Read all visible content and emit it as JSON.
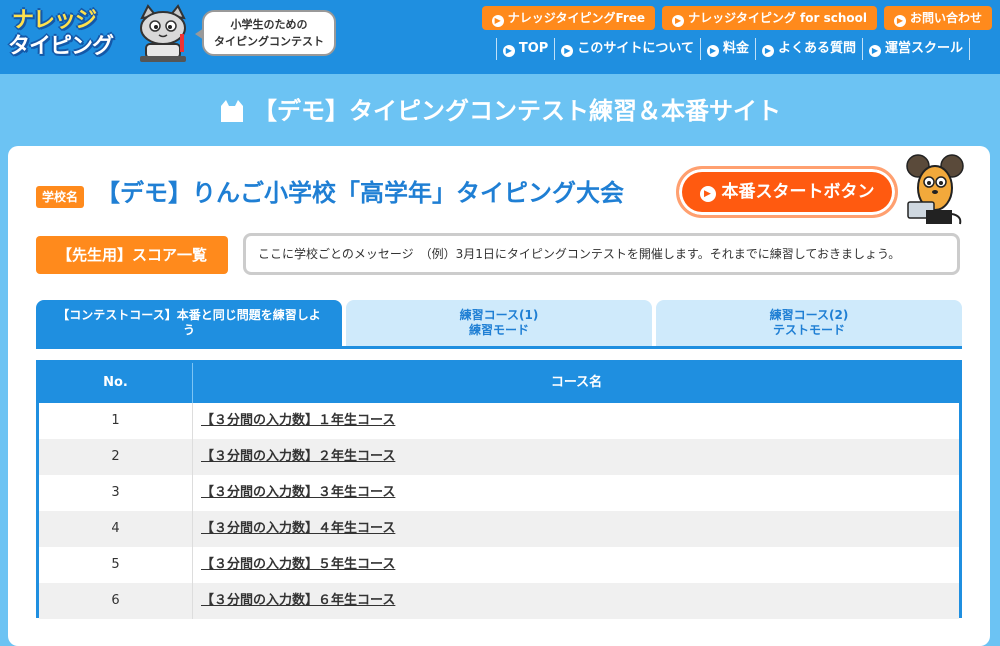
{
  "header": {
    "logo_line1": "ナレッジ",
    "logo_line2": "タイピング",
    "bubble_line1": "小学生のための",
    "bubble_line2": "タイピングコンテスト",
    "top_buttons": [
      "ナレッジタイピングFree",
      "ナレッジタイピング for school",
      "お問い合わせ"
    ],
    "nav": [
      "TOP",
      "このサイトについて",
      "料金",
      "よくある質問",
      "運営スクール"
    ]
  },
  "page_title": "【デモ】タイピングコンテスト練習＆本番サイト",
  "school": {
    "badge": "学校名",
    "title": "【デモ】りんご小学校「高学年」タイピング大会"
  },
  "start_button": "本番スタートボタン",
  "score_button": "【先生用】スコア一覧",
  "message": "ここに学校ごとのメッセージ　（例）3月1日にタイピングコンテストを開催します。それまでに練習しておきましょう。",
  "tabs": [
    {
      "line1": "【コンテストコース】本番と同じ問題を練習しよ",
      "line2": "う"
    },
    {
      "line1": "練習コース(1)",
      "line2": "練習モード"
    },
    {
      "line1": "練習コース(2)",
      "line2": "テストモード"
    }
  ],
  "table": {
    "headers": [
      "No.",
      "コース名"
    ],
    "rows": [
      {
        "no": "1",
        "name": "【３分間の入力数】１年生コース"
      },
      {
        "no": "2",
        "name": "【３分間の入力数】２年生コース"
      },
      {
        "no": "3",
        "name": "【３分間の入力数】３年生コース"
      },
      {
        "no": "4",
        "name": "【３分間の入力数】４年生コース"
      },
      {
        "no": "5",
        "name": "【３分間の入力数】５年生コース"
      },
      {
        "no": "6",
        "name": "【３分間の入力数】６年生コース"
      }
    ]
  },
  "colors": {
    "header_blue": "#1f8fe0",
    "sky_bg": "#6cc3f3",
    "orange": "#ff8a1c",
    "start_red": "#ff5a10"
  },
  "icons": [
    "play-arrow-icon",
    "cat-head-icon",
    "cat-mascot-icon",
    "mouse-mascot-icon"
  ]
}
